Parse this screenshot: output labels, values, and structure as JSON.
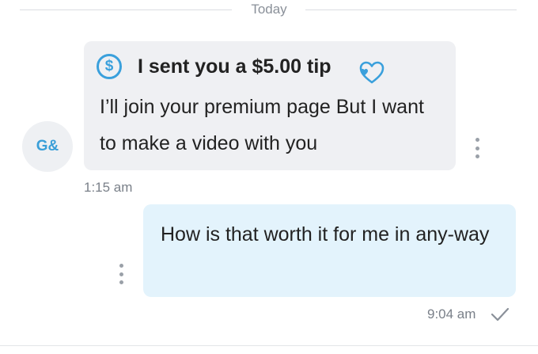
{
  "date_divider": {
    "label": "Today"
  },
  "incoming": {
    "avatar_initials": "G&",
    "tip_icon": "dollar-circle-icon",
    "tip_text": "I sent you a $5.00 tip",
    "heart_icon": "heart-icon",
    "text": "I’ll join your premium page But I want to make a video with you",
    "time": "1:15 am",
    "menu_icon": "more-vertical-icon"
  },
  "outgoing": {
    "text": "How is that worth it for me in any-way",
    "time": "9:04 am",
    "status_icon": "check-icon",
    "menu_icon": "more-vertical-icon"
  },
  "colors": {
    "accent": "#3aa0dc",
    "incoming_bubble": "#eff0f3",
    "outgoing_bubble": "#e3f3fc",
    "muted_text": "#7a8089"
  }
}
